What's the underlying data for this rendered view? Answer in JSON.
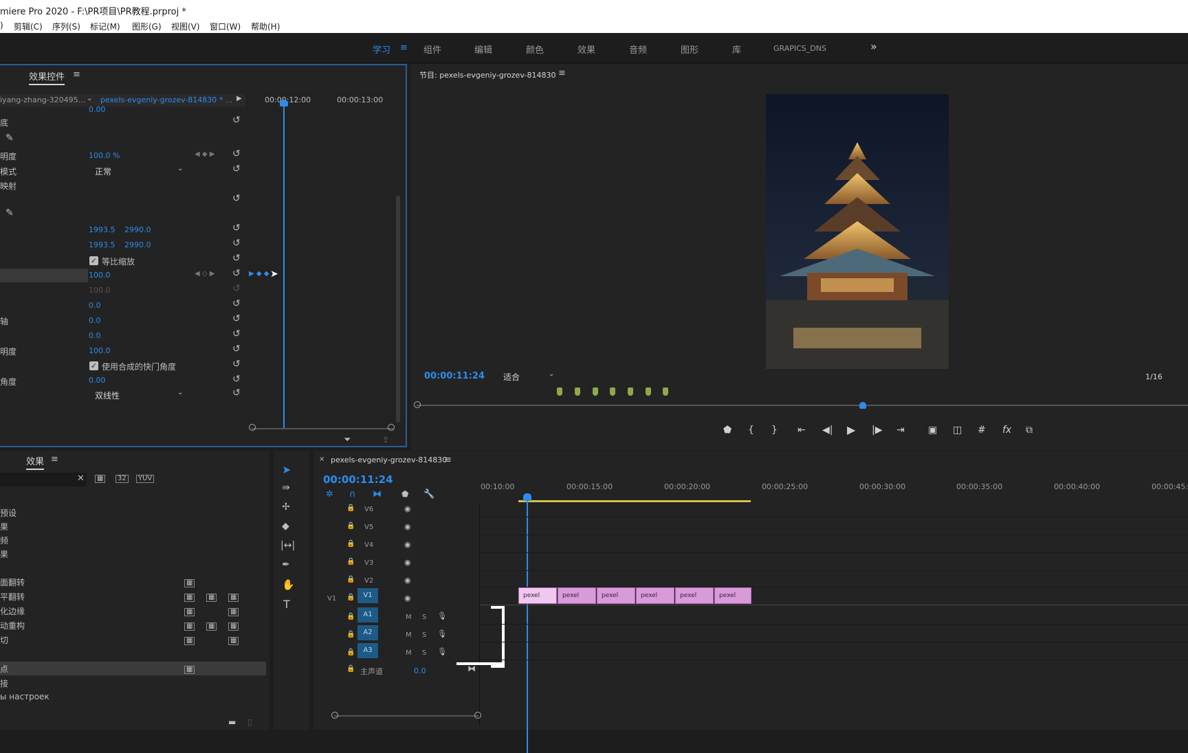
{
  "app": {
    "title": "miere Pro 2020 - F:\\PR项目\\PR教程.prproj *"
  },
  "menu": [
    ")",
    "剪辑(C)",
    "序列(S)",
    "标记(M)",
    "图形(G)",
    "视图(V)",
    "窗口(W)",
    "帮助(H)"
  ],
  "workspace": {
    "tabs": [
      "学习",
      "组件",
      "编辑",
      "颜色",
      "效果",
      "音频",
      "图形",
      "库",
      "GRAPICS_DNS"
    ],
    "active_menu_icon": "≡",
    "more": "»"
  },
  "effect_controls": {
    "title": "效果控件",
    "source_clip": "iyang-zhang-320495...",
    "sequence_clip": "pexels-evgeniy-grozev-814830 * ...",
    "timecodes": [
      "00:00:12:00",
      "00:00:13:00"
    ],
    "rows": [
      {
        "label": "",
        "value": "0.00"
      },
      {
        "label": "底",
        "value": ""
      },
      {
        "label": "",
        "value": ""
      },
      {
        "label": "明度",
        "value": "100.0 %"
      },
      {
        "label": "模式",
        "value": "正常"
      },
      {
        "label": "映射",
        "value": ""
      },
      {
        "label": "",
        "value": ""
      },
      {
        "label": "",
        "value": ""
      },
      {
        "label": "",
        "value_a": "1993.5",
        "value_b": "2990.0"
      },
      {
        "label": "",
        "value_a": "1993.5",
        "value_b": "2990.0"
      },
      {
        "label": "",
        "checkbox": "等比缩放"
      },
      {
        "label": "",
        "value": "100.0"
      },
      {
        "label": "",
        "value": "100.0"
      },
      {
        "label": "",
        "value": "0.0"
      },
      {
        "label": "轴",
        "value": "0.0"
      },
      {
        "label": "",
        "value": "0.0"
      },
      {
        "label": "明度",
        "value": "100.0"
      },
      {
        "label": "",
        "checkbox": "使用合成的快门角度"
      },
      {
        "label": "角度",
        "value": "0.00"
      },
      {
        "label": "",
        "value": "双线性"
      }
    ]
  },
  "program": {
    "title": "节目: pexels-evgeniy-grozev-814830",
    "timecode": "00:00:11:24",
    "fit": "适合",
    "resolution": "1/16"
  },
  "effects_panel": {
    "title": "效果",
    "items": [
      {
        "label": "预设"
      },
      {
        "label": "果"
      },
      {
        "label": "频"
      },
      {
        "label": "果"
      },
      {
        "label": ""
      },
      {
        "label": "面翻转"
      },
      {
        "label": "平翻转"
      },
      {
        "label": "化边缘"
      },
      {
        "label": "动重构"
      },
      {
        "label": "切"
      },
      {
        "label": ""
      },
      {
        "label": "点"
      },
      {
        "label": "接"
      },
      {
        "label": "ы настроек"
      }
    ]
  },
  "timeline": {
    "sequence_name": "pexels-evgeniy-grozev-814830",
    "timecode": "00:00:11:24",
    "ruler": [
      "00:10:00",
      "00:00:15:00",
      "00:00:20:00",
      "00:00:25:00",
      "00:00:30:00",
      "00:00:35:00",
      "00:00:40:00",
      "00:00:45:0"
    ],
    "video_tracks": [
      "V6",
      "V5",
      "V4",
      "V3",
      "V2",
      "V1"
    ],
    "v1_source": "V1",
    "audio_tracks": [
      "A1",
      "A2",
      "A3"
    ],
    "mute": "M",
    "solo": "S",
    "master": "主声道",
    "master_value": "0.0",
    "clips": [
      "pexel",
      "pexel",
      "pexel",
      "pexel",
      "pexel",
      "pexel"
    ]
  },
  "colors": {
    "accent": "#2d8ceb",
    "clip": "#d99ad9",
    "panel": "#232323",
    "focus_border": "#2b5d96"
  }
}
